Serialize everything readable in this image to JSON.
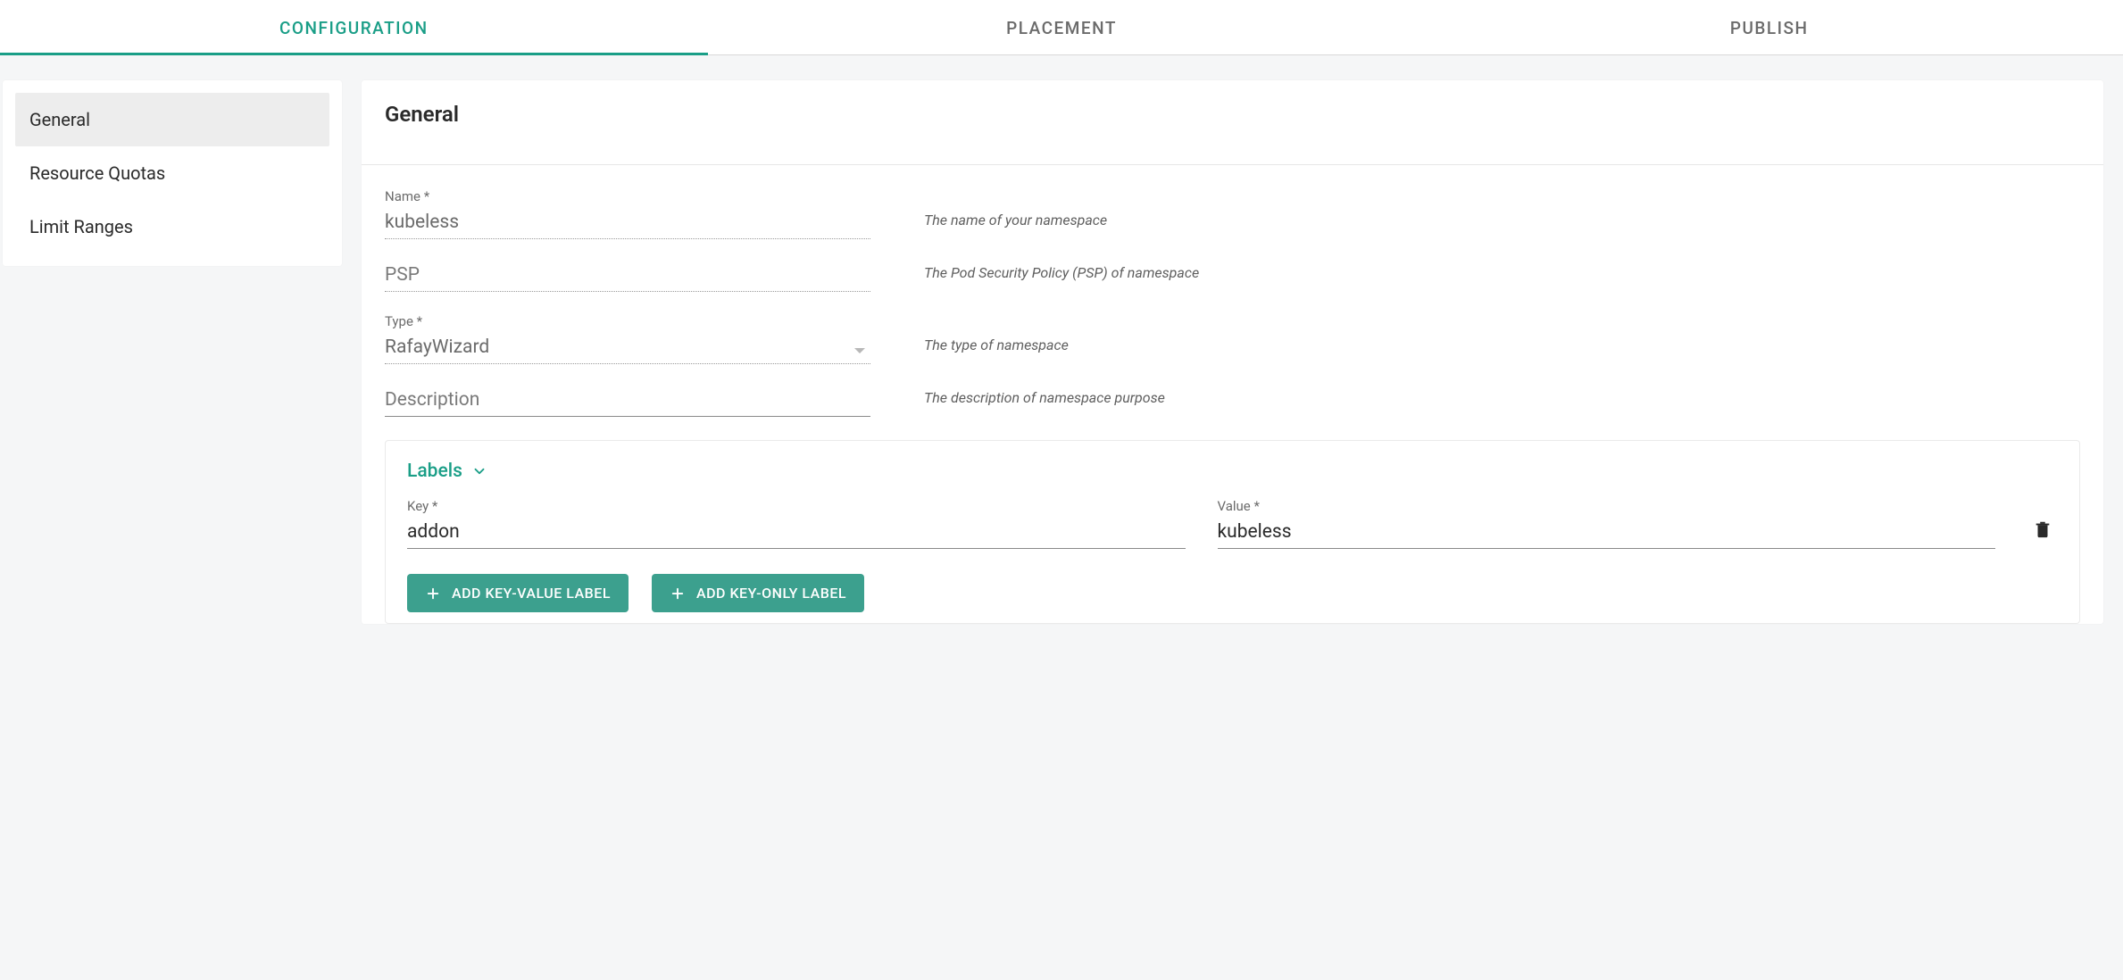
{
  "tabs": {
    "configuration": "CONFIGURATION",
    "placement": "PLACEMENT",
    "publish": "PUBLISH"
  },
  "sidebar": {
    "items": [
      "General",
      "Resource Quotas",
      "Limit Ranges"
    ]
  },
  "page": {
    "title": "General"
  },
  "form": {
    "name": {
      "label": "Name *",
      "value": "kubeless",
      "help": "The name of your namespace"
    },
    "psp": {
      "placeholder": "PSP",
      "value": "",
      "help": "The Pod Security Policy (PSP) of namespace"
    },
    "type": {
      "label": "Type *",
      "value": "RafayWizard",
      "help": "The type of namespace"
    },
    "description": {
      "placeholder": "Description",
      "value": "",
      "help": "The description of namespace purpose"
    }
  },
  "labels": {
    "title": "Labels",
    "key_label": "Key *",
    "value_label": "Value *",
    "rows": [
      {
        "key": "addon",
        "value": "kubeless"
      }
    ],
    "add_kv_button": "ADD KEY-VALUE LABEL",
    "add_ko_button": "ADD KEY-ONLY LABEL"
  }
}
